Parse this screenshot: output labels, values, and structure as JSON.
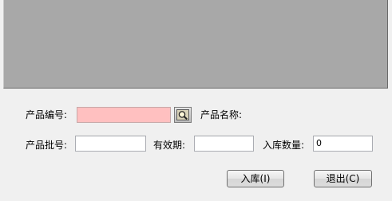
{
  "form": {
    "product_code_label": "产品编号:",
    "product_code_value": "",
    "product_name_label": "产品名称:",
    "product_name_value": "",
    "batch_no_label": "产品批号:",
    "batch_no_value": "",
    "expiry_label": "有效期:",
    "expiry_value": "",
    "quantity_label": "入库数量:",
    "quantity_value": "0"
  },
  "buttons": {
    "stock_in_label": "入库(I)",
    "exit_label": "退出(C)"
  },
  "icons": {
    "lookup": "magnifier-icon"
  },
  "colors": {
    "product_code_highlight": "#ffc0c0",
    "preview_background": "#a8a8a8"
  }
}
